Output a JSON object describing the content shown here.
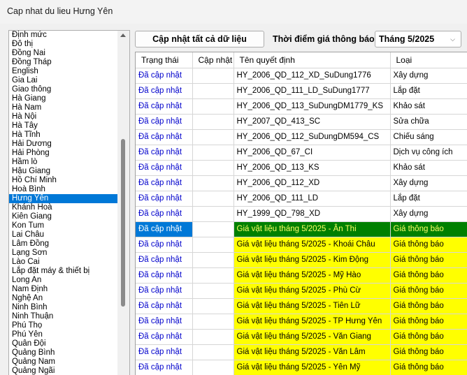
{
  "window": {
    "title": "Cap nhat du lieu Hưng Yên"
  },
  "provinces": {
    "items": [
      "Định mức",
      "Đô thị",
      "Đồng Nai",
      "Đồng Tháp",
      "English",
      "Gia Lai",
      "Giao thông",
      "Hà Giang",
      "Hà Nam",
      "Hà Nội",
      "Hà Tây",
      "Hà Tĩnh",
      "Hải Dương",
      "Hải Phòng",
      "Hầm lò",
      "Hậu Giang",
      "Hồ Chí Minh",
      "Hoà Bình",
      "Hưng Yên",
      "Khánh Hoà",
      "Kiên Giang",
      "Kon Tum",
      "Lai Châu",
      "Lâm Đồng",
      "Lạng Sơn",
      "Lào Cai",
      "Lắp đặt máy & thiết bị",
      "Long An",
      "Nam Định",
      "Nghệ An",
      "Ninh Bình",
      "Ninh Thuận",
      "Phú Thọ",
      "Phú Yên",
      "Quân Đội",
      "Quảng Bình",
      "Quảng Nam",
      "Quảng Ngãi"
    ],
    "selected": "Hưng Yên"
  },
  "toolbar": {
    "update_all_label": "Cập nhật tất cả dữ liệu",
    "time_label": "Thời điểm giá thông báo",
    "month_value": "Tháng 5/2025"
  },
  "grid": {
    "columns": [
      "Trạng thái",
      "Cập nhật",
      "Tên quyết định",
      "Loại"
    ],
    "rows": [
      {
        "status": "Đã cập nhật",
        "update": "",
        "name": "HY_2006_QD_112_XD_SuDung1776",
        "type": "Xây dựng",
        "style": "normal"
      },
      {
        "status": "Đã cập nhật",
        "update": "",
        "name": "HY_2006_QD_111_LD_SuDung1777",
        "type": "Lắp đặt",
        "style": "normal"
      },
      {
        "status": "Đã cập nhật",
        "update": "",
        "name": "HY_2006_QD_113_SuDungDM1779_KS",
        "type": "Khảo sát",
        "style": "normal"
      },
      {
        "status": "Đã cập nhật",
        "update": "",
        "name": "HY_2007_QD_413_SC",
        "type": "Sửa chữa",
        "style": "normal"
      },
      {
        "status": "Đã cập nhật",
        "update": "",
        "name": "HY_2006_QD_112_SuDungDM594_CS",
        "type": "Chiếu sáng",
        "style": "normal"
      },
      {
        "status": "Đã cập nhật",
        "update": "",
        "name": "HY_2006_QD_67_CI",
        "type": "Dịch vụ công ích",
        "style": "normal"
      },
      {
        "status": "Đã cập nhật",
        "update": "",
        "name": "HY_2006_QD_113_KS",
        "type": "Khảo sát",
        "style": "normal"
      },
      {
        "status": "Đã cập nhật",
        "update": "",
        "name": "HY_2006_QD_112_XD",
        "type": "Xây dựng",
        "style": "normal"
      },
      {
        "status": "Đã cập nhật",
        "update": "",
        "name": "HY_2006_QD_111_LD",
        "type": "Lắp đặt",
        "style": "normal"
      },
      {
        "status": "Đã cập nhật",
        "update": "",
        "name": "HY_1999_QD_798_XD",
        "type": "Xây dựng",
        "style": "normal"
      },
      {
        "status": "Đã cập nhật",
        "update": "",
        "name": "Giá vật liệu tháng 5/2025 - Ân Thi",
        "type": "Giá thông báo",
        "style": "green"
      },
      {
        "status": "Đã cập nhật",
        "update": "",
        "name": "Giá vật liệu tháng 5/2025 - Khoái Châu",
        "type": "Giá thông báo",
        "style": "yellow"
      },
      {
        "status": "Đã cập nhật",
        "update": "",
        "name": "Giá vật liệu tháng 5/2025 - Kim Động",
        "type": "Giá thông báo",
        "style": "yellow"
      },
      {
        "status": "Đã cập nhật",
        "update": "",
        "name": "Giá vật liệu tháng 5/2025 - Mỹ Hào",
        "type": "Giá thông báo",
        "style": "yellow"
      },
      {
        "status": "Đã cập nhật",
        "update": "",
        "name": "Giá vật liệu tháng 5/2025 - Phù Cừ",
        "type": "Giá thông báo",
        "style": "yellow"
      },
      {
        "status": "Đã cập nhật",
        "update": "",
        "name": "Giá vật liệu tháng 5/2025 - Tiên Lữ",
        "type": "Giá thông báo",
        "style": "yellow"
      },
      {
        "status": "Đã cập nhật",
        "update": "",
        "name": "Giá vật liệu tháng 5/2025 - TP Hưng Yên",
        "type": "Giá thông báo",
        "style": "yellow"
      },
      {
        "status": "Đã cập nhật",
        "update": "",
        "name": "Giá vật liệu tháng 5/2025 - Văn Giang",
        "type": "Giá thông báo",
        "style": "yellow"
      },
      {
        "status": "Đã cập nhật",
        "update": "",
        "name": "Giá vật liệu tháng 5/2025 - Văn Lâm",
        "type": "Giá thông báo",
        "style": "yellow"
      },
      {
        "status": "Đã cập nhật",
        "update": "",
        "name": "Giá vật liệu tháng 5/2025 - Yên Mỹ",
        "type": "Giá thông báo",
        "style": "yellow"
      }
    ]
  },
  "colors": {
    "highlight_yellow": "#ffff00",
    "highlight_green": "#008000",
    "selection_blue": "#0078d7",
    "status_text": "#0000cc"
  }
}
